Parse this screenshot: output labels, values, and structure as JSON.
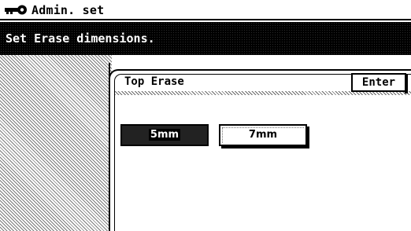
{
  "title_bar": {
    "icon": "key-icon",
    "title": "Admin. set"
  },
  "message_bar": {
    "text": "Set Erase dimensions."
  },
  "dialog": {
    "title": "Top Erase",
    "enter_label": "Enter",
    "options": [
      {
        "label": "5mm",
        "selected": true
      },
      {
        "label": "7mm",
        "selected": false
      }
    ]
  }
}
